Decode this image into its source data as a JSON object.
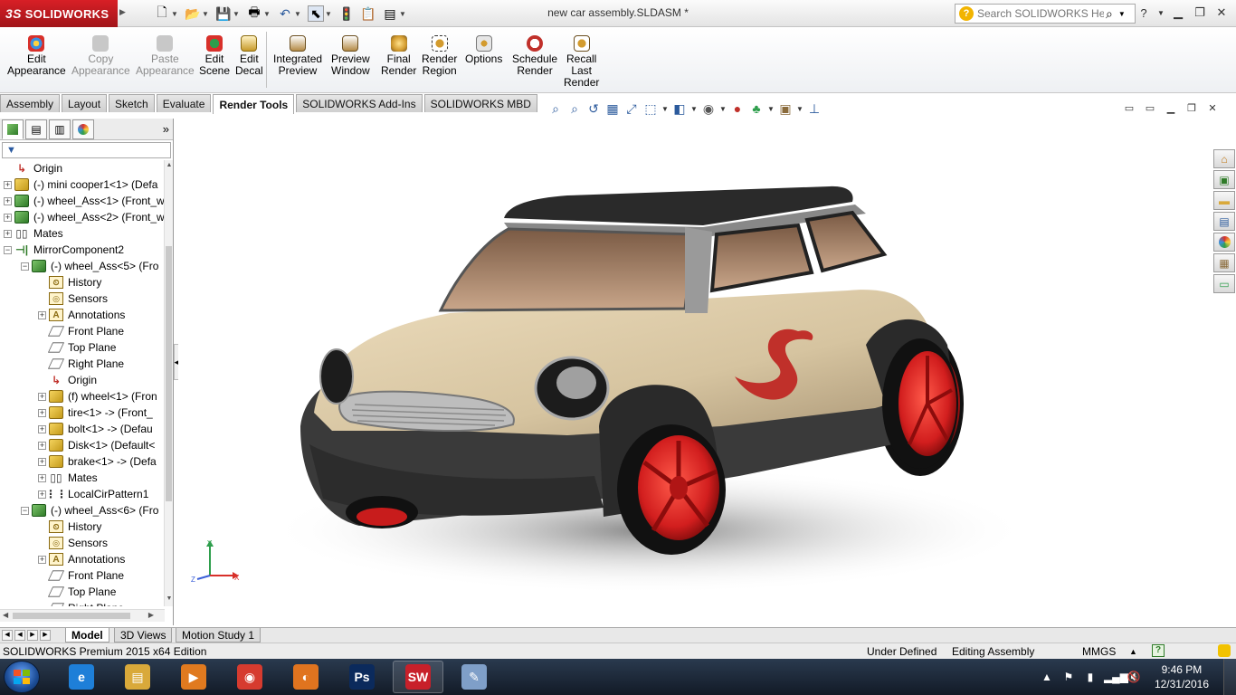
{
  "app": {
    "logo_text": "SOLIDWORKS",
    "logo_mark": "3S",
    "doc_title": "new car assembly.SLDASM *"
  },
  "quick_access": [
    {
      "name": "new-document",
      "glyph": "🗋"
    },
    {
      "name": "open",
      "glyph": "📂"
    },
    {
      "name": "save",
      "glyph": "💾"
    },
    {
      "name": "print",
      "glyph": "🖶"
    },
    {
      "name": "undo",
      "glyph": "↶"
    },
    {
      "name": "select",
      "glyph": "⬉"
    },
    {
      "name": "rebuild",
      "glyph": "🚦"
    },
    {
      "name": "file-properties",
      "glyph": "📋"
    },
    {
      "name": "options",
      "glyph": "▤"
    }
  ],
  "help_search": {
    "placeholder": "Search SOLIDWORKS Help"
  },
  "ribbon": {
    "buttons": [
      {
        "id": "edit-appearance",
        "lines": [
          "Edit",
          "Appearance"
        ],
        "enabled": true,
        "color": "#3b8fe0"
      },
      {
        "id": "copy-appearance",
        "lines": [
          "Copy",
          "Appearance"
        ],
        "enabled": false,
        "color": "#b0b0b0"
      },
      {
        "id": "paste-appearance",
        "lines": [
          "Paste",
          "Appearance"
        ],
        "enabled": false,
        "color": "#b0b0b0"
      },
      {
        "id": "edit-scene",
        "lines": [
          "Edit",
          "Scene"
        ],
        "enabled": true,
        "color": "#2e9e4c"
      },
      {
        "id": "edit-decal",
        "lines": [
          "Edit",
          "Decal"
        ],
        "enabled": true,
        "color": "#c79a2a"
      },
      {
        "id": "integrated-preview",
        "lines": [
          "Integrated",
          "Preview"
        ],
        "enabled": true,
        "color": "#8a6b3b"
      },
      {
        "id": "preview-window",
        "lines": [
          "Preview",
          "Window"
        ],
        "enabled": true,
        "color": "#8a6b3b"
      },
      {
        "id": "final-render",
        "lines": [
          "Final",
          "Render"
        ],
        "enabled": true,
        "color": "#d39b2e"
      },
      {
        "id": "render-region",
        "lines": [
          "Render",
          "Region"
        ],
        "enabled": true,
        "color": "#9b7a3a"
      },
      {
        "id": "options",
        "lines": [
          "Options"
        ],
        "enabled": true,
        "color": "#7d7d7d"
      },
      {
        "id": "schedule-render",
        "lines": [
          "Schedule",
          "Render"
        ],
        "enabled": true,
        "color": "#c0302a"
      },
      {
        "id": "recall-last-render",
        "lines": [
          "Recall",
          "Last",
          "Render"
        ],
        "enabled": true,
        "color": "#8a6b3b"
      }
    ]
  },
  "tabs": [
    {
      "label": "Assembly",
      "active": false
    },
    {
      "label": "Layout",
      "active": false
    },
    {
      "label": "Sketch",
      "active": false
    },
    {
      "label": "Evaluate",
      "active": false
    },
    {
      "label": "Render Tools",
      "active": true
    },
    {
      "label": "SOLIDWORKS Add-Ins",
      "active": false
    },
    {
      "label": "SOLIDWORKS MBD",
      "active": false
    }
  ],
  "hud": [
    {
      "name": "zoom-to-fit",
      "glyph": "🔍"
    },
    {
      "name": "zoom-to-area",
      "glyph": "🔎"
    },
    {
      "name": "previous-view",
      "glyph": "↺"
    },
    {
      "name": "section-view",
      "glyph": "▦"
    },
    {
      "name": "dynamic-annotation",
      "glyph": "⤢"
    },
    {
      "name": "view-orientation",
      "glyph": "⬚"
    },
    {
      "name": "display-style",
      "glyph": "◧"
    },
    {
      "name": "hide-show-items",
      "glyph": "◉"
    },
    {
      "name": "edit-appearance",
      "glyph": "●"
    },
    {
      "name": "apply-scene",
      "glyph": "♣"
    },
    {
      "name": "view-settings",
      "glyph": "▣"
    },
    {
      "name": "rotate",
      "glyph": "⊥"
    }
  ],
  "feature_tree": {
    "filter_label": "▼",
    "nodes": [
      {
        "label": "Origin",
        "icon": "origin",
        "indent": 0,
        "expander": ""
      },
      {
        "label": "(-) mini cooper1<1> (Defa",
        "icon": "part",
        "indent": 0,
        "expander": "+"
      },
      {
        "label": "(-) wheel_Ass<1> (Front_w",
        "icon": "asm",
        "indent": 0,
        "expander": "+"
      },
      {
        "label": "(-) wheel_Ass<2> (Front_w",
        "icon": "asm",
        "indent": 0,
        "expander": "+"
      },
      {
        "label": "Mates",
        "icon": "mates",
        "indent": 0,
        "expander": "+"
      },
      {
        "label": "MirrorComponent2",
        "icon": "mirror",
        "indent": 0,
        "expander": "−"
      },
      {
        "label": "(-) wheel_Ass<5> (Fro",
        "icon": "asm",
        "indent": 1,
        "expander": "−"
      },
      {
        "label": "History",
        "icon": "hist",
        "indent": 2,
        "expander": ""
      },
      {
        "label": "Sensors",
        "icon": "sens",
        "indent": 2,
        "expander": ""
      },
      {
        "label": "Annotations",
        "icon": "anno",
        "indent": 2,
        "expander": "+"
      },
      {
        "label": "Front Plane",
        "icon": "plane",
        "indent": 2,
        "expander": ""
      },
      {
        "label": "Top Plane",
        "icon": "plane",
        "indent": 2,
        "expander": ""
      },
      {
        "label": "Right Plane",
        "icon": "plane",
        "indent": 2,
        "expander": ""
      },
      {
        "label": "Origin",
        "icon": "origin",
        "indent": 2,
        "expander": ""
      },
      {
        "label": "(f) wheel<1> (Fron",
        "icon": "part",
        "indent": 2,
        "expander": "+"
      },
      {
        "label": "tire<1> -> (Front_",
        "icon": "part",
        "indent": 2,
        "expander": "+"
      },
      {
        "label": "bolt<1> -> (Defau",
        "icon": "part",
        "indent": 2,
        "expander": "+"
      },
      {
        "label": "Disk<1> (Default<",
        "icon": "part",
        "indent": 2,
        "expander": "+"
      },
      {
        "label": "brake<1> -> (Defa",
        "icon": "part",
        "indent": 2,
        "expander": "+"
      },
      {
        "label": "Mates",
        "icon": "mates",
        "indent": 2,
        "expander": "+"
      },
      {
        "label": "LocalCirPattern1",
        "icon": "pattern",
        "indent": 2,
        "expander": "+"
      },
      {
        "label": "(-) wheel_Ass<6> (Fro",
        "icon": "asm",
        "indent": 1,
        "expander": "−"
      },
      {
        "label": "History",
        "icon": "hist",
        "indent": 2,
        "expander": ""
      },
      {
        "label": "Sensors",
        "icon": "sens",
        "indent": 2,
        "expander": ""
      },
      {
        "label": "Annotations",
        "icon": "anno",
        "indent": 2,
        "expander": "+"
      },
      {
        "label": "Front Plane",
        "icon": "plane",
        "indent": 2,
        "expander": ""
      },
      {
        "label": "Top Plane",
        "icon": "plane",
        "indent": 2,
        "expander": ""
      },
      {
        "label": "Right Plane",
        "icon": "plane",
        "indent": 2,
        "expander": ""
      }
    ]
  },
  "triad": {
    "x": "X",
    "y": "Y",
    "z": "Z"
  },
  "bottom_tabs": [
    {
      "label": "Model",
      "active": true
    },
    {
      "label": "3D Views",
      "active": false
    },
    {
      "label": "Motion Study 1",
      "active": false
    }
  ],
  "status": {
    "edition": "SOLIDWORKS Premium 2015 x64 Edition",
    "state": "Under Defined",
    "mode": "Editing Assembly",
    "units": "MMGS",
    "units_arrow": "▲",
    "help": "?"
  },
  "taskbar": {
    "apps": [
      {
        "name": "internet-explorer",
        "label": "e",
        "color": "#1e7fd8"
      },
      {
        "name": "file-explorer",
        "label": "▤",
        "color": "#d9a93a"
      },
      {
        "name": "media-player",
        "label": "▶",
        "color": "#e07a1f"
      },
      {
        "name": "chrome",
        "label": "◉",
        "color": "#d63b2f"
      },
      {
        "name": "firefox",
        "label": "◐",
        "color": "#e0741f"
      },
      {
        "name": "photoshop",
        "label": "Ps",
        "color": "#0b2a5c"
      },
      {
        "name": "solidworks",
        "label": "SW",
        "color": "#c8202a"
      },
      {
        "name": "paint",
        "label": "✎",
        "color": "#7f9fc8"
      }
    ],
    "time": "9:46 PM",
    "date": "12/31/2016"
  },
  "colors": {
    "car_body": "#d8c9a8",
    "car_roof": "#2a2a2a",
    "wheel": "#d21e1e",
    "accent": "#c0302a"
  }
}
